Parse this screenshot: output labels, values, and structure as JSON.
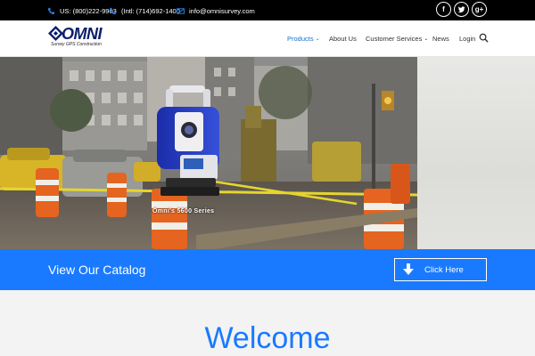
{
  "topbar": {
    "phone_us": "US: (800)222-9903",
    "phone_intl": "(Intl: (714)692-1400",
    "email": "info@omnisurvey.com",
    "social": [
      {
        "icon": "facebook-icon",
        "glyph": "f"
      },
      {
        "icon": "twitter-icon",
        "glyph": "t"
      },
      {
        "icon": "google-plus-icon",
        "glyph": "g+"
      }
    ]
  },
  "header": {
    "logo_word": "OMNI",
    "logo_tagline": "Survey GPS Construction",
    "nav": [
      {
        "label": "Products",
        "has_dropdown": true,
        "active": true
      },
      {
        "label": "About Us",
        "has_dropdown": false,
        "active": false
      },
      {
        "label": "Customer Services",
        "has_dropdown": true,
        "active": false
      },
      {
        "label": "News",
        "has_dropdown": false,
        "active": false
      },
      {
        "label": "Login",
        "has_dropdown": false,
        "active": false
      }
    ],
    "search_icon": "search-icon"
  },
  "hero": {
    "caption": "Omni's 5600 Series"
  },
  "catalog": {
    "title": "View Our Catalog",
    "button_label": "Click Here",
    "button_icon": "arrow-down-icon"
  },
  "welcome": {
    "heading": "Welcome"
  },
  "colors": {
    "accent": "#1a7aff",
    "topbar": "#000000",
    "logo": "#0c1f6b",
    "nav_active": "#1b6dc9"
  }
}
